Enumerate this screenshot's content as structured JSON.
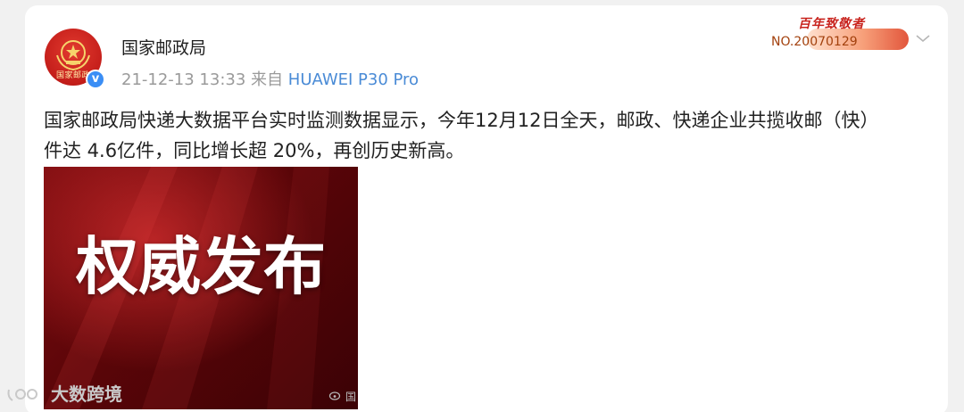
{
  "post": {
    "author": "国家邮政局",
    "avatar_label": "国家邮政",
    "timestamp": "21-12-13 13:33",
    "source_prefix": "来自",
    "source_device": "HUAWEI P30 Pro",
    "text_line1": "国家邮政局快递大数据平台实时监测数据显示，今年12月12日全天，邮政、快递企业共揽收邮（快）",
    "text_line2": "件达 4.6亿件，同比增长超 20%，再创历史新高。",
    "image": {
      "title": "权威发布",
      "watermark": "国"
    }
  },
  "badge": {
    "title": "百年致敬者",
    "number": "NO.20070129"
  },
  "page_watermark": "大数跨境",
  "icons": {
    "verified": "verified-v-icon",
    "menu": "chevron-down-icon",
    "weibo": "weibo-icon"
  },
  "colors": {
    "source_link": "#4a8bd6",
    "verified": "#3b8ef5",
    "accent_red": "#c8231d"
  }
}
